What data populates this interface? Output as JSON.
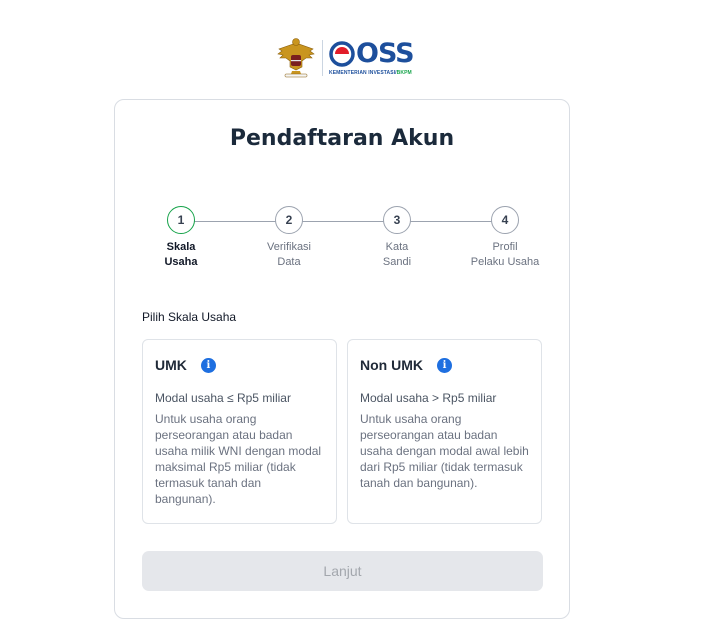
{
  "logo": {
    "brand": "OSS",
    "subtitle_main": "KEMENTERIAN INVESTASI/",
    "subtitle_accent": "BKPM"
  },
  "title": "Pendaftaran Akun",
  "steps": [
    {
      "number": "1",
      "line1": "Skala",
      "line2": "Usaha",
      "active": true
    },
    {
      "number": "2",
      "line1": "Verifikasi",
      "line2": "Data",
      "active": false
    },
    {
      "number": "3",
      "line1": "Kata",
      "line2": "Sandi",
      "active": false
    },
    {
      "number": "4",
      "line1": "Profil",
      "line2": "Pelaku Usaha",
      "active": false
    }
  ],
  "section_label": "Pilih Skala Usaha",
  "options": [
    {
      "title": "UMK",
      "subtitle": "Modal usaha ≤ Rp5 miliar",
      "description": "Untuk usaha orang perseorangan atau badan usaha milik WNI dengan modal maksimal Rp5 miliar (tidak termasuk tanah dan bangunan)."
    },
    {
      "title": "Non UMK",
      "subtitle": "Modal usaha > Rp5 miliar",
      "description": "Untuk usaha orang perseorangan atau badan usaha dengan modal awal lebih dari Rp5 miliar (tidak termasuk tanah dan bangunan)."
    }
  ],
  "button": {
    "label": "Lanjut",
    "disabled": true
  },
  "colors": {
    "brand_blue": "#1d4f9c",
    "accent_green": "#16a34a",
    "info_blue": "#1e6fe0",
    "text_dark": "#1b2a3b"
  }
}
